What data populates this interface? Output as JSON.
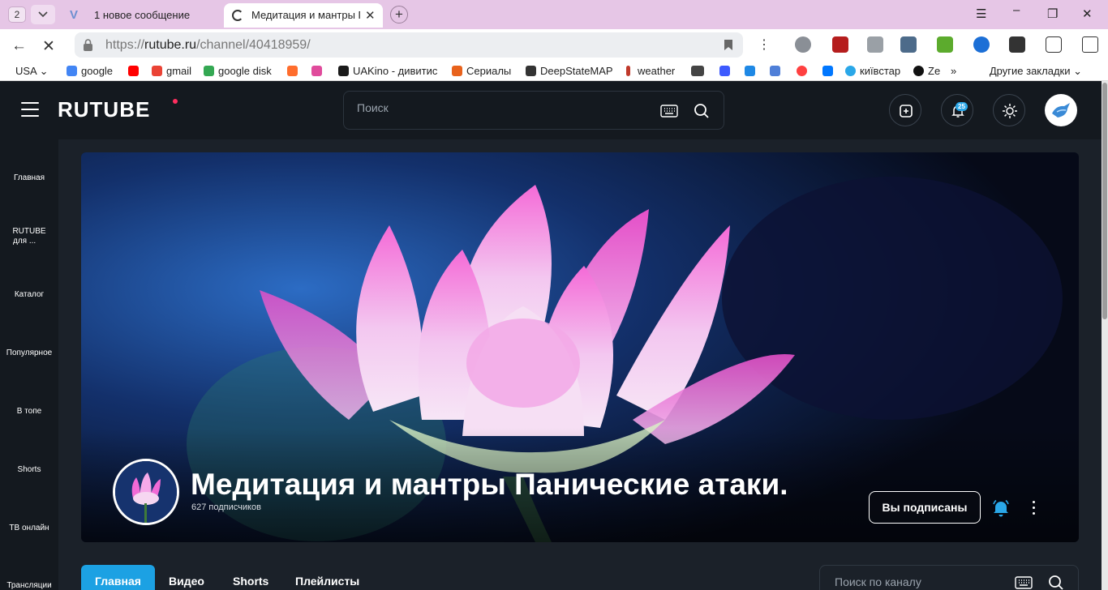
{
  "browser": {
    "tab_count": "2",
    "tabs": [
      {
        "title": "1 новое сообщение"
      },
      {
        "title": "Медитация и мантры Панические атаки."
      }
    ],
    "url_prefix": "https://",
    "url_domain": "rutube.ru",
    "url_path": "/channel/40418959/",
    "bookmarks": [
      {
        "label": "USA",
        "icon_color": ""
      },
      {
        "label": "google",
        "icon_color": "#4285f4"
      },
      {
        "label": "",
        "icon_color": "#ff0000"
      },
      {
        "label": "gmail",
        "icon_color": "#ea4335"
      },
      {
        "label": "google disk",
        "icon_color": "#34a853"
      },
      {
        "label": "",
        "icon_color": "#ff6d2d"
      },
      {
        "label": "",
        "icon_color": "#e04b9c"
      },
      {
        "label": "UAKino - дивитис",
        "icon_color": "#1a1a1a"
      },
      {
        "label": "Сериалы",
        "icon_color": "#e8621c"
      },
      {
        "label": "DeepStateMAP",
        "icon_color": "#333333"
      },
      {
        "label": "weather",
        "icon_color": "#c0392b"
      },
      {
        "label": "",
        "icon_color": "#444444"
      },
      {
        "label": "",
        "icon_color": "#3d5afe"
      },
      {
        "label": "",
        "icon_color": "#1e88e5"
      },
      {
        "label": "",
        "icon_color": "#4f7fd8"
      },
      {
        "label": "",
        "icon_color": "#ff4040"
      },
      {
        "label": "",
        "icon_color": "#0077ff"
      },
      {
        "label": "київстар",
        "icon_color": "#2aa7e8"
      },
      {
        "label": "Ze",
        "icon_color": "#111111"
      }
    ],
    "bookmarks_more": "»",
    "other_bookmarks": "Другие закладки",
    "colors": {
      "tabbar": "#e6c6e6",
      "accent": "#1ca1e3"
    }
  },
  "rutube": {
    "logo": "RUTUBE",
    "search_placeholder": "Поиск",
    "notification_count": "25",
    "sidebar": [
      {
        "label": "Главная"
      },
      {
        "label": "RUTUBE"
      },
      {
        "label": "для ..."
      },
      {
        "label": "Каталог"
      },
      {
        "label": "Популярное"
      },
      {
        "label": "В топе"
      },
      {
        "label": "Shorts"
      },
      {
        "label": "ТВ онлайн"
      },
      {
        "label": "Трансляции"
      }
    ],
    "channel": {
      "name": "Медитация и мантры Панические атаки.",
      "subscribers": "627 подписчиков",
      "subscribe_label": "Вы подписаны"
    },
    "channel_tabs": [
      {
        "label": "Главная",
        "active": true
      },
      {
        "label": "Видео",
        "active": false
      },
      {
        "label": "Shorts",
        "active": false
      },
      {
        "label": "Плейлисты",
        "active": false
      }
    ],
    "channel_search_placeholder": "Поиск по каналу",
    "icons": [
      "menu-icon",
      "search-icon",
      "keyboard-icon",
      "upload-icon",
      "bell-icon",
      "theme-icon",
      "more-icon",
      "lock-icon",
      "back-icon",
      "close-icon"
    ]
  }
}
